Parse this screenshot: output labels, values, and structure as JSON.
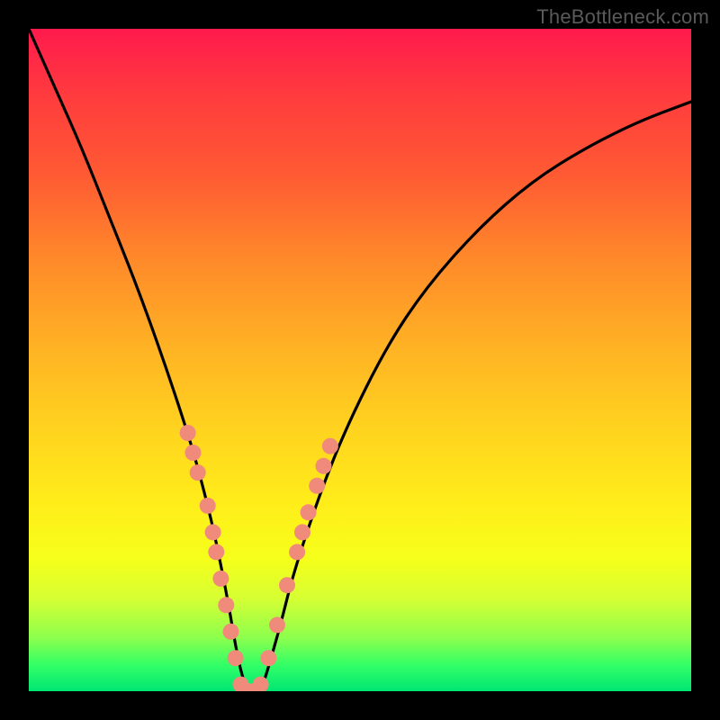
{
  "watermark": {
    "text": "TheBottleneck.com"
  },
  "chart_data": {
    "type": "line",
    "title": "",
    "xlabel": "",
    "ylabel": "",
    "xlim": [
      0,
      100
    ],
    "ylim": [
      0,
      100
    ],
    "grid": false,
    "legend": false,
    "annotations": [],
    "series": [
      {
        "name": "bottleneck-curve",
        "color": "#000000",
        "x": [
          0,
          4,
          8,
          12,
          16,
          20,
          24,
          26,
          28,
          30,
          31,
          32,
          33,
          34,
          35,
          36,
          38,
          40,
          44,
          48,
          54,
          60,
          68,
          76,
          84,
          92,
          100
        ],
        "values": [
          100,
          91,
          82,
          72,
          62,
          51,
          39,
          32,
          24,
          14,
          8,
          3,
          0,
          0,
          0,
          3,
          10,
          18,
          30,
          40,
          52,
          61,
          70,
          77,
          82,
          86,
          89
        ]
      }
    ],
    "markers": {
      "name": "highlight-dots",
      "color": "#f08a7a",
      "radius_px": 9,
      "points": [
        {
          "x": 24.0,
          "y": 39
        },
        {
          "x": 24.8,
          "y": 36
        },
        {
          "x": 25.5,
          "y": 33
        },
        {
          "x": 27.0,
          "y": 28
        },
        {
          "x": 27.8,
          "y": 24
        },
        {
          "x": 28.3,
          "y": 21
        },
        {
          "x": 29.0,
          "y": 17
        },
        {
          "x": 29.8,
          "y": 13
        },
        {
          "x": 30.5,
          "y": 9
        },
        {
          "x": 31.2,
          "y": 5
        },
        {
          "x": 32.0,
          "y": 1
        },
        {
          "x": 33.0,
          "y": 0
        },
        {
          "x": 34.0,
          "y": 0
        },
        {
          "x": 35.0,
          "y": 1
        },
        {
          "x": 36.2,
          "y": 5
        },
        {
          "x": 37.5,
          "y": 10
        },
        {
          "x": 39.0,
          "y": 16
        },
        {
          "x": 40.5,
          "y": 21
        },
        {
          "x": 41.3,
          "y": 24
        },
        {
          "x": 42.2,
          "y": 27
        },
        {
          "x": 43.5,
          "y": 31
        },
        {
          "x": 44.5,
          "y": 34
        },
        {
          "x": 45.5,
          "y": 37
        }
      ]
    }
  }
}
